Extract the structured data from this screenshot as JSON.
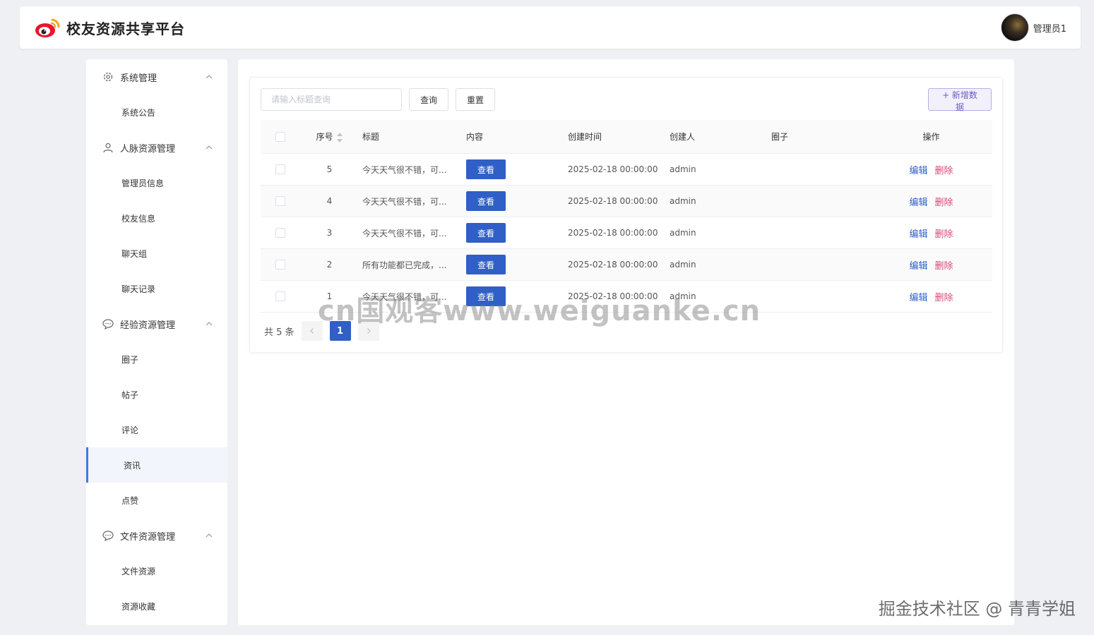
{
  "header": {
    "app_title": "校友资源共享平台",
    "user_name": "管理员1"
  },
  "sidebar": {
    "groups": [
      {
        "label": "系统管理",
        "icon": "gear-icon",
        "items": [
          "系统公告"
        ]
      },
      {
        "label": "人脉资源管理",
        "icon": "user-icon",
        "items": [
          "管理员信息",
          "校友信息",
          "聊天组",
          "聊天记录"
        ]
      },
      {
        "label": "经验资源管理",
        "icon": "chat-icon",
        "items": [
          "圈子",
          "帖子",
          "评论",
          "资讯",
          "点赞"
        ]
      },
      {
        "label": "文件资源管理",
        "icon": "chat-icon",
        "items": [
          "文件资源",
          "资源收藏"
        ]
      }
    ],
    "active_item": "资讯"
  },
  "toolbar": {
    "search_placeholder": "请输入标题查询",
    "query_label": "查询",
    "reset_label": "重置",
    "add_label": "+ 新增数据"
  },
  "table": {
    "headers": [
      "序号",
      "标题",
      "内容",
      "创建时间",
      "创建人",
      "圈子",
      "操作"
    ],
    "view_label": "查看",
    "edit_label": "编辑",
    "delete_label": "删除",
    "rows": [
      {
        "no": "5",
        "title": "今天天气很不错，可...",
        "time": "2025-02-18 00:00:00",
        "creator": "admin",
        "circle": ""
      },
      {
        "no": "4",
        "title": "今天天气很不错，可...",
        "time": "2025-02-18 00:00:00",
        "creator": "admin",
        "circle": ""
      },
      {
        "no": "3",
        "title": "今天天气很不错，可...",
        "time": "2025-02-18 00:00:00",
        "creator": "admin",
        "circle": ""
      },
      {
        "no": "2",
        "title": "所有功能都已完成，...",
        "time": "2025-02-18 00:00:00",
        "creator": "admin",
        "circle": ""
      },
      {
        "no": "1",
        "title": "今天天气很不错，可...",
        "time": "2025-02-18 00:00:00",
        "creator": "admin",
        "circle": ""
      }
    ]
  },
  "pagination": {
    "total_text": "共 5 条",
    "current_page": "1"
  },
  "overlay": {
    "watermark": "cn国观客www.weiguanke.cn",
    "credit": "掘金技术社区 @ 青青学姐"
  }
}
